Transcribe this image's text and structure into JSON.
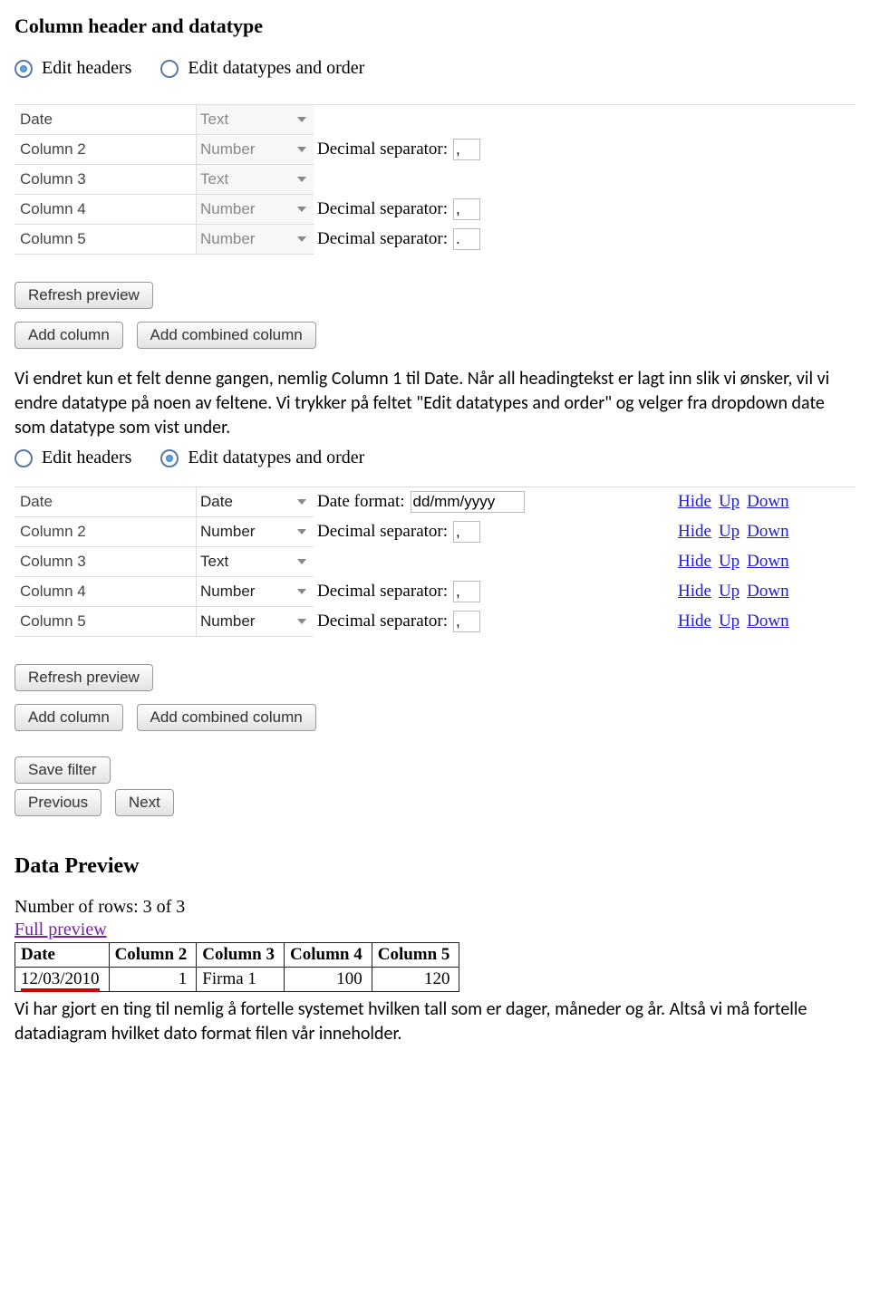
{
  "section1": {
    "heading": "Column header and datatype",
    "radios": {
      "edit_headers": "Edit headers",
      "edit_datatypes": "Edit datatypes and order"
    },
    "rows": [
      {
        "name": "Date",
        "type": "Text",
        "extra_label": "",
        "extra_value": ""
      },
      {
        "name": "Column 2",
        "type": "Number",
        "extra_label": "Decimal separator:",
        "extra_value": ","
      },
      {
        "name": "Column 3",
        "type": "Text",
        "extra_label": "",
        "extra_value": ""
      },
      {
        "name": "Column 4",
        "type": "Number",
        "extra_label": "Decimal separator:",
        "extra_value": ","
      },
      {
        "name": "Column 5",
        "type": "Number",
        "extra_label": "Decimal separator:",
        "extra_value": "."
      }
    ],
    "buttons": {
      "refresh": "Refresh preview",
      "add_column": "Add column",
      "add_combined": "Add combined column"
    }
  },
  "paragraph1": "Vi endret kun et felt denne gangen, nemlig Column 1 til Date. Når all headingtekst er lagt inn slik vi ønsker, vil vi endre datatype på noen av feltene. Vi trykker på feltet \"Edit datatypes and order\" og velger fra dropdown date som datatype som vist under.",
  "section2": {
    "radios": {
      "edit_headers": "Edit headers",
      "edit_datatypes": "Edit datatypes and order"
    },
    "rows": [
      {
        "name": "Date",
        "type": "Date",
        "extra_label": "Date format:",
        "extra_value": "dd/mm/yyyy"
      },
      {
        "name": "Column 2",
        "type": "Number",
        "extra_label": "Decimal separator:",
        "extra_value": ","
      },
      {
        "name": "Column 3",
        "type": "Text",
        "extra_label": "",
        "extra_value": ""
      },
      {
        "name": "Column 4",
        "type": "Number",
        "extra_label": "Decimal separator:",
        "extra_value": ","
      },
      {
        "name": "Column 5",
        "type": "Number",
        "extra_label": "Decimal separator:",
        "extra_value": ","
      }
    ],
    "links": {
      "hide": "Hide",
      "up": "Up",
      "down": "Down"
    },
    "buttons": {
      "refresh": "Refresh preview",
      "add_column": "Add column",
      "add_combined": "Add combined column",
      "save_filter": "Save filter",
      "previous": "Previous",
      "next": "Next"
    }
  },
  "preview": {
    "heading": "Data Preview",
    "nrows": "Number of rows: 3 of 3",
    "full_link": "Full preview",
    "headers": [
      "Date",
      "Column 2",
      "Column 3",
      "Column 4",
      "Column 5"
    ],
    "row": {
      "c0": "12/03/2010",
      "c1": "1",
      "c2": "Firma 1",
      "c3": "100",
      "c4": "120"
    }
  },
  "paragraph2": "Vi har gjort en ting til nemlig å fortelle systemet hvilken tall som er dager, måneder og år. Altså vi må fortelle datadiagram hvilket dato format filen vår inneholder."
}
